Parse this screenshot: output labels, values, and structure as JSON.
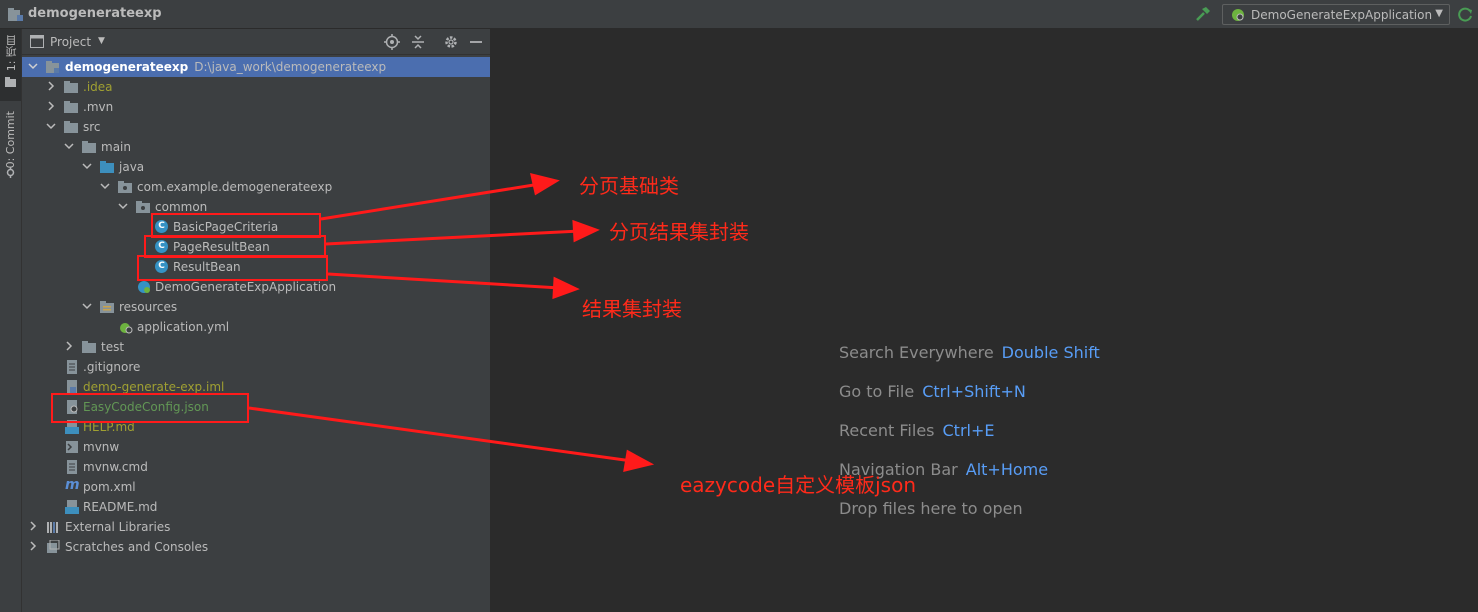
{
  "title_bar": {
    "project_name": "demogenerateexp",
    "run_config": "DemoGenerateExpApplication"
  },
  "stripe": {
    "project_tab": "1: 项目",
    "commit_tab": "0: Commit"
  },
  "panel": {
    "title": "Project"
  },
  "tree": {
    "root": {
      "label": "demogenerateexp",
      "path": "D:\\java_work\\demogenerateexp"
    },
    "idea": ".idea",
    "mvn": ".mvn",
    "src": "src",
    "main": "main",
    "java": "java",
    "package": "com.example.demogenerateexp",
    "common": "common",
    "basic_page_criteria": "BasicPageCriteria",
    "page_result_bean": "PageResultBean",
    "result_bean": "ResultBean",
    "app_class": "DemoGenerateExpApplication",
    "resources": "resources",
    "application_yml": "application.yml",
    "test": "test",
    "gitignore": ".gitignore",
    "iml": "demo-generate-exp.iml",
    "easycode": "EasyCodeConfig.json",
    "help": "HELP.md",
    "mvnw": "mvnw",
    "mvnw_cmd": "mvnw.cmd",
    "pom": "pom.xml",
    "readme": "README.md",
    "external_libraries": "External Libraries",
    "scratches": "Scratches and Consoles"
  },
  "hints": [
    {
      "label": "Search Everywhere",
      "key": "Double Shift"
    },
    {
      "label": "Go to File",
      "key": "Ctrl+Shift+N"
    },
    {
      "label": "Recent Files",
      "key": "Ctrl+E"
    },
    {
      "label": "Navigation Bar",
      "key": "Alt+Home"
    },
    {
      "label": "Drop files here to open",
      "key": ""
    }
  ],
  "annotations": {
    "basic": "分页基础类",
    "page_result": "分页结果集封装",
    "result": "结果集封装",
    "easycode": "eazycode自定义模板json"
  },
  "colors": {
    "selection": "#4b6eaf",
    "annotation_red": "#ff1a1a",
    "shortcut_blue": "#589df6",
    "vcs_olive": "#a0a032",
    "vcs_green": "#629755"
  }
}
